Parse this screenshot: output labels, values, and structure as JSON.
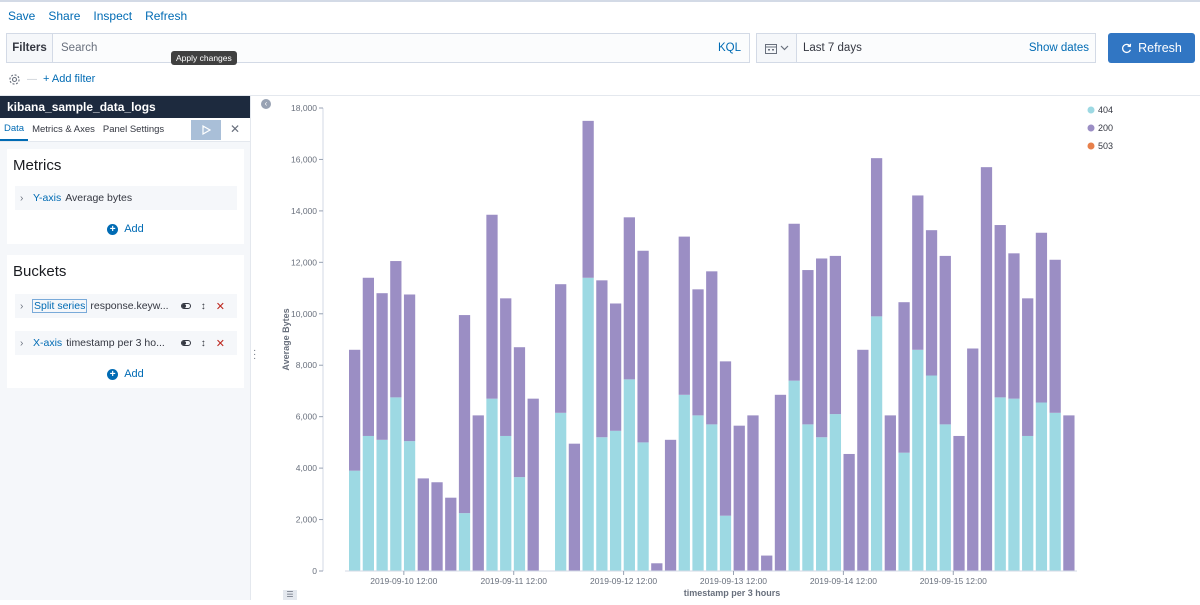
{
  "toolbar": {
    "save": "Save",
    "share": "Share",
    "inspect": "Inspect",
    "refresh": "Refresh"
  },
  "query": {
    "filters_label": "Filters",
    "search_placeholder": "Search",
    "language": "KQL"
  },
  "time": {
    "range_label": "Last 7 days",
    "show_dates": "Show dates",
    "refresh_button": "Refresh"
  },
  "filter_bar": {
    "add_filter": "+ Add filter"
  },
  "sidebar": {
    "index_pattern": "kibana_sample_data_logs",
    "tabs": [
      "Data",
      "Metrics & Axes",
      "Panel Settings"
    ],
    "apply_tooltip": "Apply changes",
    "metrics": {
      "title": "Metrics",
      "rows": [
        {
          "type": "Y-axis",
          "desc": "Average bytes"
        }
      ],
      "add": "Add"
    },
    "buckets": {
      "title": "Buckets",
      "rows": [
        {
          "type": "Split series",
          "desc": "response.keyw..."
        },
        {
          "type": "X-axis",
          "desc": "timestamp per 3 ho..."
        }
      ],
      "add": "Add"
    }
  },
  "colors": {
    "s404": "#9dd9e3",
    "s200": "#9b8ec4",
    "s503": "#e7804b",
    "accent": "#006bb4",
    "refresh_btn": "#3176c3"
  },
  "chart_data": {
    "type": "bar",
    "stacked": true,
    "ylabel": "Average Bytes",
    "xlabel": "timestamp per 3 hours",
    "ylim": [
      0,
      18000
    ],
    "y_ticks": [
      "0",
      "2,000",
      "4,000",
      "6,000",
      "8,000",
      "10,000",
      "12,000",
      "14,000",
      "16,000",
      "18,000"
    ],
    "x_tick_labels": [
      "2019-09-10 12:00",
      "2019-09-11 12:00",
      "2019-09-12 12:00",
      "2019-09-13 12:00",
      "2019-09-14 12:00",
      "2019-09-15 12:00"
    ],
    "x_tick_bar_index": [
      3,
      11,
      19,
      27,
      35,
      43
    ],
    "legend": [
      "404",
      "200",
      "503"
    ],
    "series": [
      {
        "name": "404",
        "values": [
          3900,
          5250,
          5100,
          6750,
          5050,
          0,
          0,
          0,
          2250,
          0,
          6700,
          5250,
          3650,
          0,
          null,
          6150,
          0,
          11400,
          5200,
          5450,
          7450,
          5000,
          0,
          0,
          6850,
          6050,
          5700,
          2150,
          0,
          0,
          0,
          0,
          7400,
          5700,
          5200,
          6100,
          0,
          0,
          9900,
          0,
          4600,
          8600,
          7600,
          5700,
          0,
          0,
          0,
          6750,
          6700,
          5250,
          6550,
          6150,
          0
        ]
      },
      {
        "name": "200",
        "values": [
          4700,
          6150,
          5700,
          5300,
          5700,
          3600,
          3450,
          2850,
          7700,
          6050,
          7150,
          5350,
          5050,
          6700,
          null,
          5000,
          4950,
          6100,
          6100,
          4950,
          6300,
          7450,
          300,
          5100,
          6150,
          4900,
          5950,
          6000,
          5650,
          6050,
          600,
          6850,
          6100,
          6000,
          6950,
          6150,
          4550,
          8600,
          6150,
          6050,
          5850,
          6000,
          5650,
          6550,
          5250,
          8650,
          15700,
          6700,
          5650,
          5350,
          6600,
          5950,
          6050
        ]
      },
      {
        "name": "503",
        "values": []
      }
    ]
  }
}
